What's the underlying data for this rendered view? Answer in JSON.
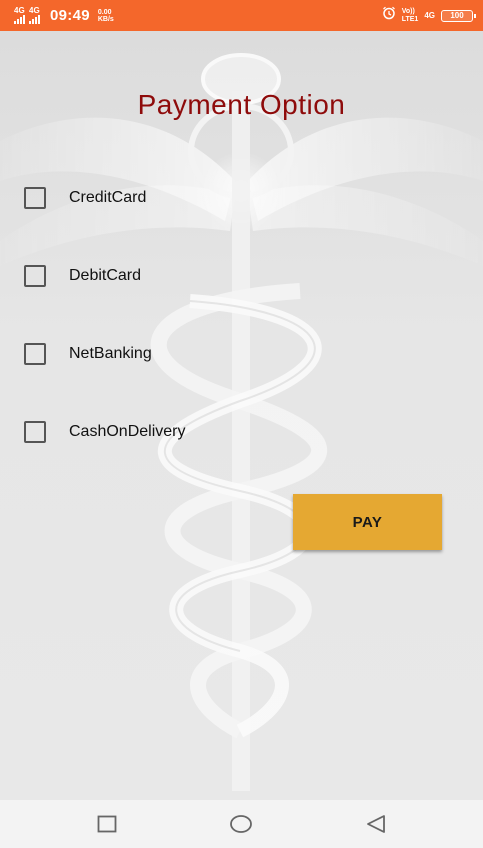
{
  "status_bar": {
    "network1": "4G",
    "network2": "4G",
    "time": "09:49",
    "speed_value": "0.00",
    "speed_unit": "KB/s",
    "volte_top": "Vo))",
    "volte_bottom": "LTE1",
    "sig_4g": "4G",
    "battery": "100",
    "icons": [
      "signal-icon",
      "alarm-icon",
      "battery-icon"
    ],
    "color": "#f4672b"
  },
  "page": {
    "title": "Payment Option",
    "title_color": "#8e0b0b",
    "options": [
      {
        "label": "CreditCard",
        "checked": false
      },
      {
        "label": "DebitCard",
        "checked": false
      },
      {
        "label": "NetBanking",
        "checked": false
      },
      {
        "label": "CashOnDelivery",
        "checked": false
      }
    ],
    "pay_label": "PAY",
    "pay_color": "#e5a832",
    "background_icon": "caduceus-icon"
  },
  "nav_bar": {
    "icons": [
      "recent-apps-icon",
      "home-icon",
      "back-icon"
    ]
  }
}
